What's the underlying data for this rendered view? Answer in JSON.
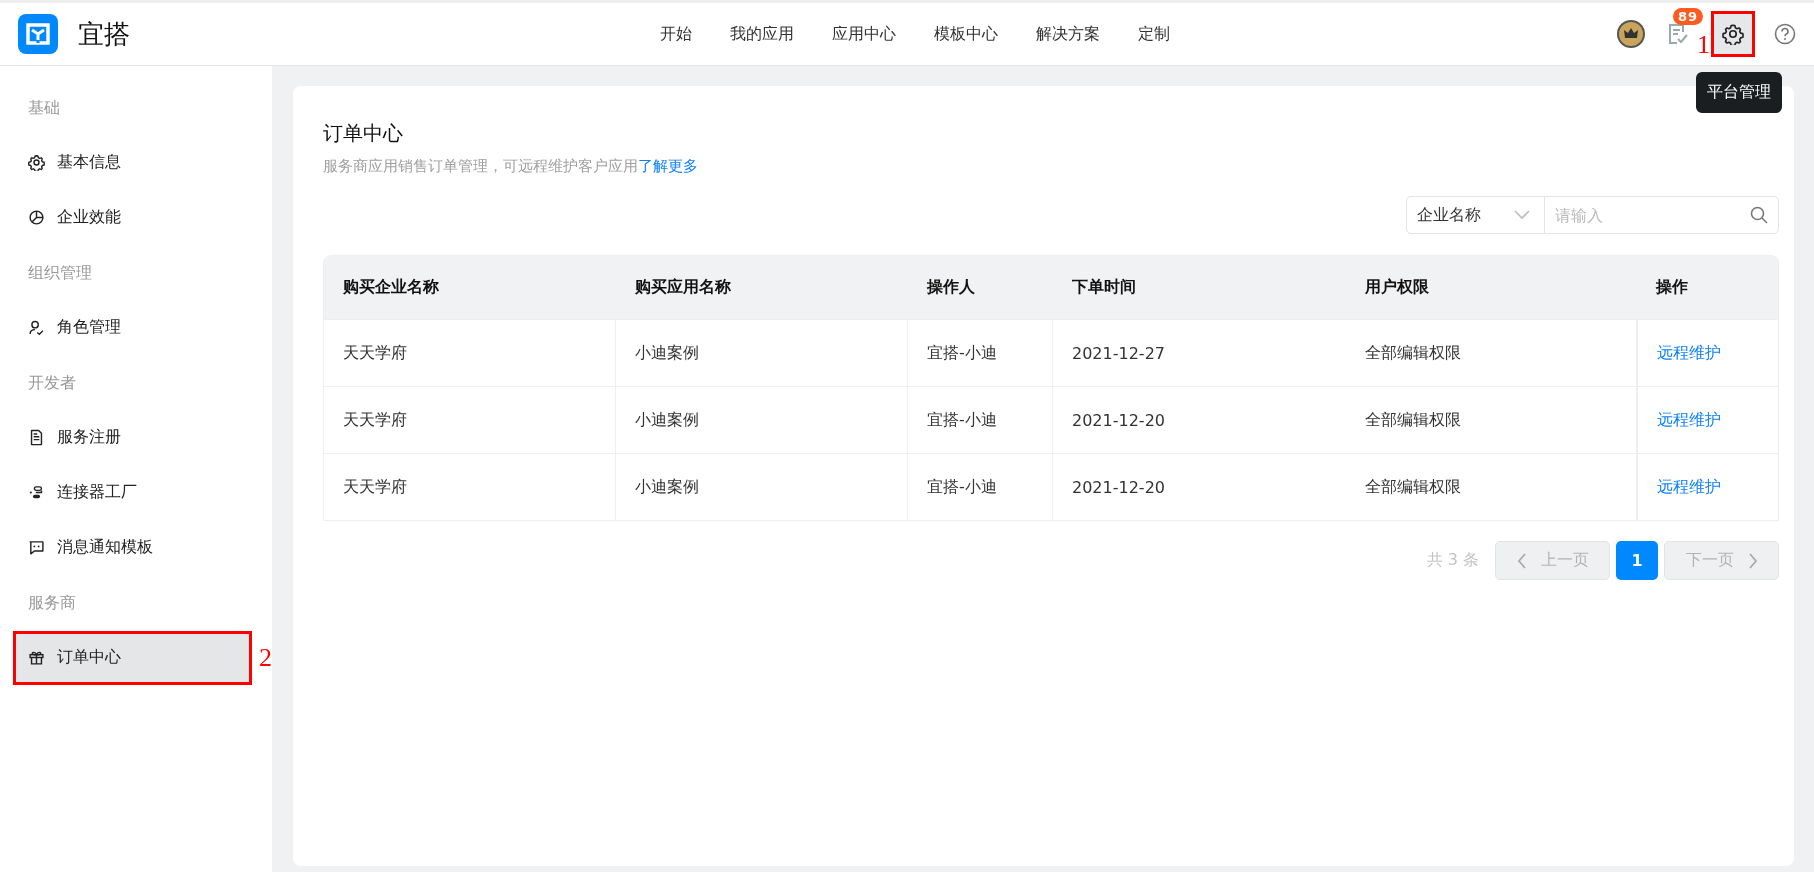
{
  "header": {
    "app_name": "宜搭",
    "nav": [
      {
        "label": "开始",
        "selected": false
      },
      {
        "label": "我的应用",
        "selected": false
      },
      {
        "label": "应用中心",
        "selected": false
      },
      {
        "label": "模板中心",
        "selected": false
      },
      {
        "label": "解决方案",
        "selected": false
      },
      {
        "label": "定制",
        "selected": false
      }
    ],
    "task_badge": "89",
    "tooltip": "平台管理"
  },
  "sidebar": {
    "groups": [
      {
        "title": "基础",
        "children": [
          {
            "label": "基本信息",
            "selected": false
          },
          {
            "label": "企业效能",
            "selected": false
          }
        ]
      },
      {
        "title": "组织管理",
        "children": [
          {
            "label": "角色管理",
            "selected": false
          }
        ]
      },
      {
        "title": "开发者",
        "children": [
          {
            "label": "服务注册",
            "selected": false
          },
          {
            "label": "连接器工厂",
            "selected": false
          },
          {
            "label": "消息通知模板",
            "selected": false
          }
        ]
      },
      {
        "title": "服务商",
        "children": [
          {
            "label": "订单中心",
            "selected": true
          }
        ]
      }
    ]
  },
  "page": {
    "title": "订单中心",
    "description": "服务商应用销售订单管理，可远程维护客户应用",
    "learn_more_link": "了解更多",
    "search": {
      "filter": "企业名称",
      "placeholder": "请输入"
    },
    "table": {
      "columns": [
        "购买企业名称",
        "购买应用名称",
        "操作人",
        "下单时间",
        "用户权限",
        "操作"
      ],
      "rows": [
        [
          "天天学府",
          "小迪案例",
          "宜搭-小迪",
          "2021-12-27",
          "全部编辑权限",
          "远程维护"
        ],
        [
          "天天学府",
          "小迪案例",
          "宜搭-小迪",
          "2021-12-20",
          "全部编辑权限",
          "远程维护"
        ],
        [
          "天天学府",
          "小迪案例",
          "宜搭-小迪",
          "2021-12-20",
          "全部编辑权限",
          "远程维护"
        ]
      ]
    },
    "pagination": {
      "total": "共 3 条",
      "prev": "上一页",
      "pages": [
        {
          "label": "1",
          "selected": true
        }
      ],
      "next": "下一页"
    }
  },
  "annotations": [
    {
      "label": "1"
    },
    {
      "label": "2"
    }
  ]
}
